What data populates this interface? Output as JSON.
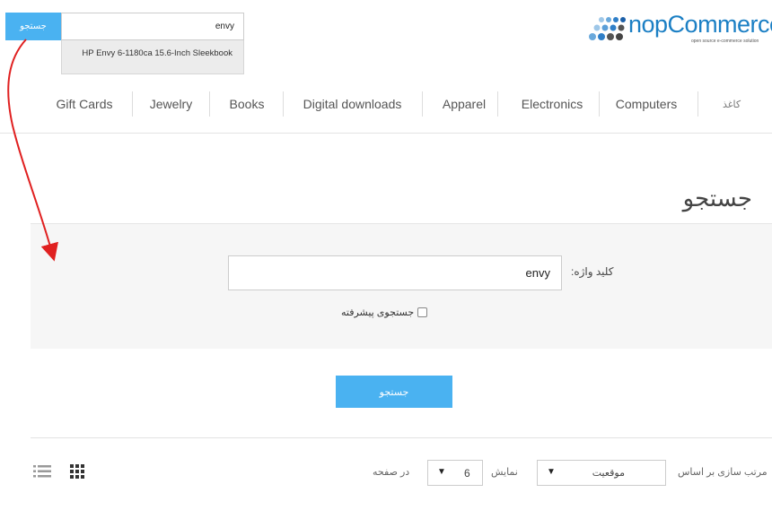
{
  "header": {
    "search_button_label": "جستجو",
    "search_value": "envy",
    "autocomplete_item": "HP Envy 6-1180ca 15.6-Inch Sleekbook",
    "logo_text": "nopCommerce",
    "logo_tagline": "open source e-commerce solution"
  },
  "nav": {
    "items": [
      "کاغذ",
      "Computers",
      "Electronics",
      "Apparel",
      "Digital downloads",
      "Books",
      "Jewelry",
      "Gift Cards"
    ]
  },
  "page": {
    "title": "جستجو"
  },
  "search_form": {
    "keyword_label": "کلید واژه:",
    "keyword_value": "envy",
    "advanced_search_label": "جستجوی پیشرفته",
    "advanced_search_checked": false,
    "submit_label": "جستجو"
  },
  "results_controls": {
    "sort_label": "مرتب سازی بر اساس",
    "sort_value": "موقعیت",
    "show_label": "نمایش",
    "page_size_value": "6",
    "per_page_label": "در صفحه"
  },
  "colors": {
    "accent": "#4ab2f1",
    "annotation_arrow": "#e02020"
  },
  "icons": [
    "list-view-icon",
    "grid-view-icon",
    "dropdown-arrow-icon",
    "annotation-arrow"
  ]
}
